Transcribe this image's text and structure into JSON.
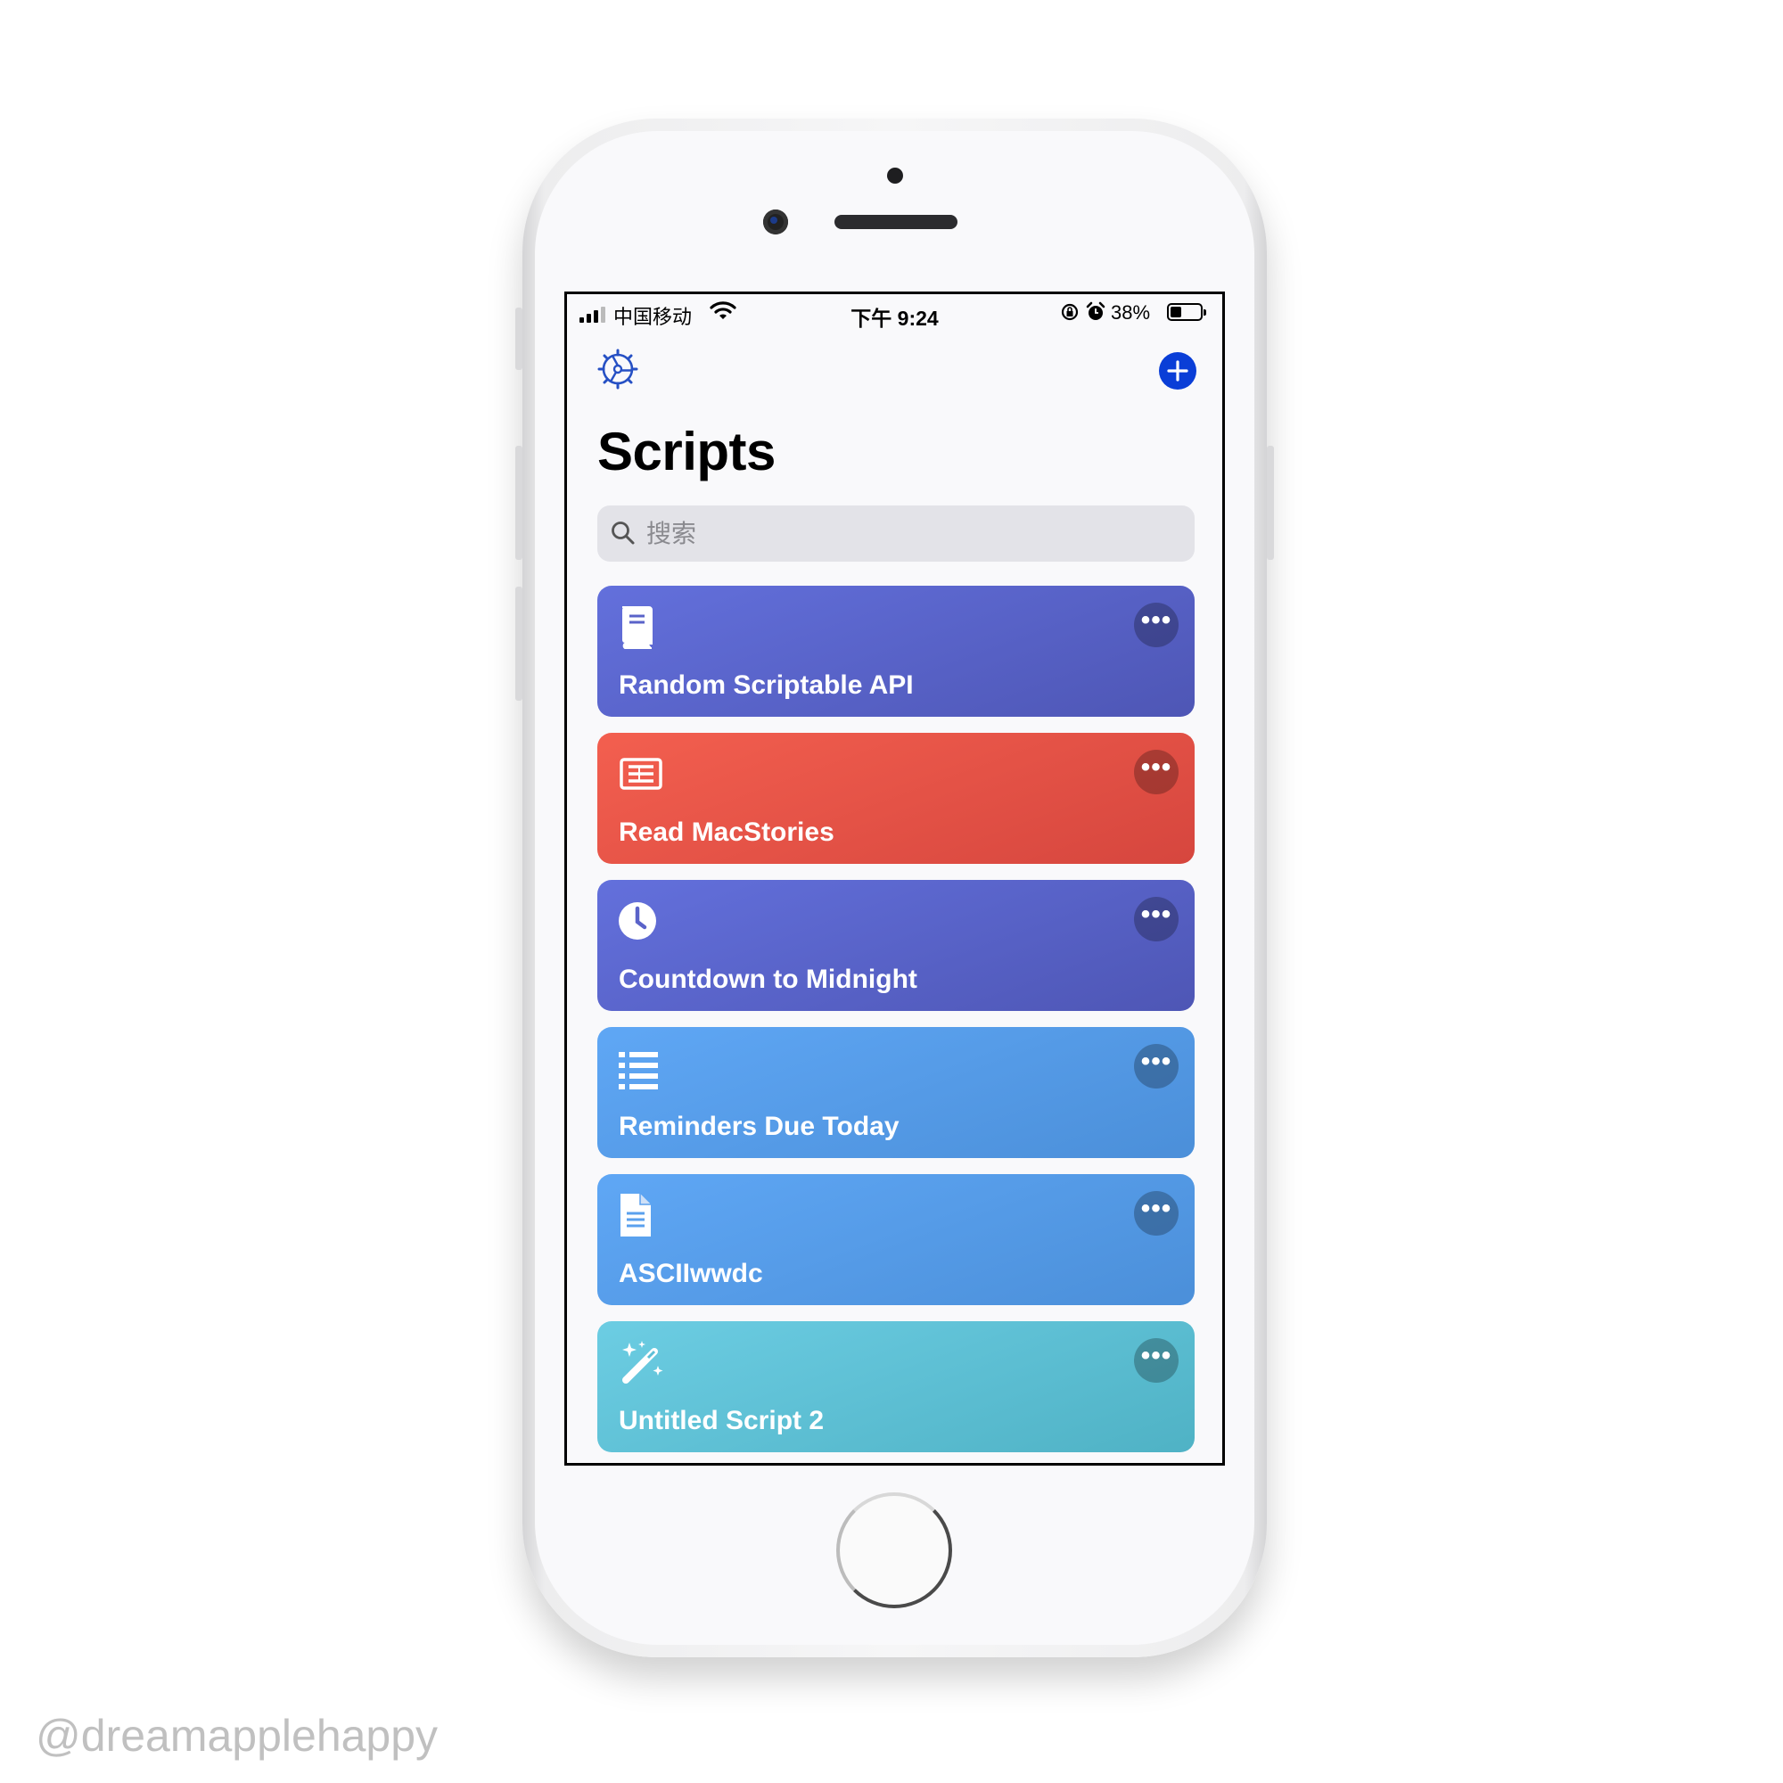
{
  "status_bar": {
    "carrier": "中国移动",
    "time": "下午 9:24",
    "battery": "38%"
  },
  "page": {
    "title": "Scripts",
    "search_placeholder": "搜索"
  },
  "scripts": [
    {
      "title": "Random Scriptable API",
      "icon": "book-icon",
      "color_start": "#6370dc",
      "color_end": "#4e56b5",
      "more_label": "•••"
    },
    {
      "title": "Read MacStories",
      "icon": "newspaper-icon",
      "color_start": "#f35f4f",
      "color_end": "#d6463e",
      "more_label": "•••"
    },
    {
      "title": "Countdown to Midnight",
      "icon": "clock-icon",
      "color_start": "#6370dc",
      "color_end": "#4e56b5",
      "more_label": "•••"
    },
    {
      "title": "Reminders Due Today",
      "icon": "list-icon",
      "color_start": "#5fa7f5",
      "color_end": "#4b8fd9",
      "more_label": "•••"
    },
    {
      "title": "ASCIIwwdc",
      "icon": "document-icon",
      "color_start": "#5fa7f5",
      "color_end": "#4b8fd9",
      "more_label": "•••"
    },
    {
      "title": "Untitled Script 2",
      "icon": "magic-wand-icon",
      "color_start": "#6ccde3",
      "color_end": "#4fb2c5",
      "more_label": "•••"
    }
  ],
  "watermark": "@dreamapplehappy",
  "colors": {
    "accent": "#0a3ed7"
  }
}
